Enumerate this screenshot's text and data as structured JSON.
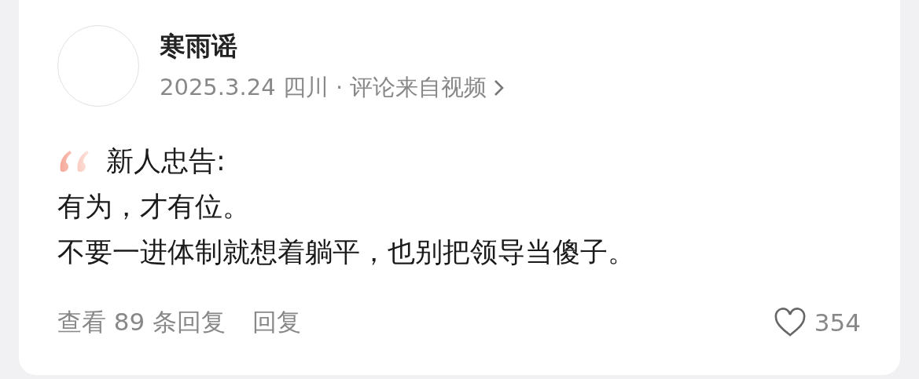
{
  "comment": {
    "author": "寒雨谣",
    "date": "2025.3.24",
    "location": "四川",
    "separator": "·",
    "source": "评论来自视频",
    "lines": [
      "新人忠告:",
      "有为，才有位。",
      "不要一进体制就想着躺平，也别把领导当傻子。"
    ],
    "view_replies": "查看 89 条回复",
    "reply": "回复",
    "likes": "354",
    "liked": false
  }
}
